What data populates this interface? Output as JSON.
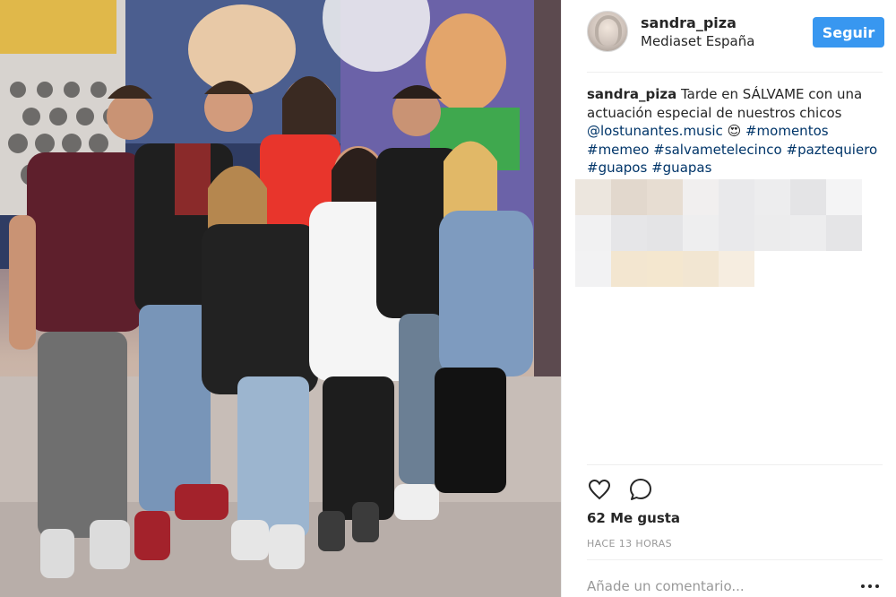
{
  "post": {
    "username": "sandra_piza",
    "location": "Mediaset España",
    "follow_label": "Seguir",
    "caption": {
      "username": "sandra_piza",
      "text_1": " Tarde en SÁLVAME con una actuación especial de nuestros chicos ",
      "mention": "@lostunantes.music",
      "emoji": " 😍 ",
      "hashtags": [
        "#momentos",
        "#memeo",
        "#salvametelecinco",
        "#paztequiero",
        "#guapos",
        "#guapas"
      ]
    },
    "likes_label": "62 Me gusta",
    "timestamp": "HACE 13 HORAS",
    "comment_placeholder": "Añade un comentario..."
  },
  "icons": {
    "like": "heart-icon",
    "comment": "comment-bubble-icon",
    "more": "more-options-icon"
  },
  "colors": {
    "follow_button": "#3897f0",
    "link": "#003569",
    "muted": "#999999",
    "text": "#262626"
  }
}
